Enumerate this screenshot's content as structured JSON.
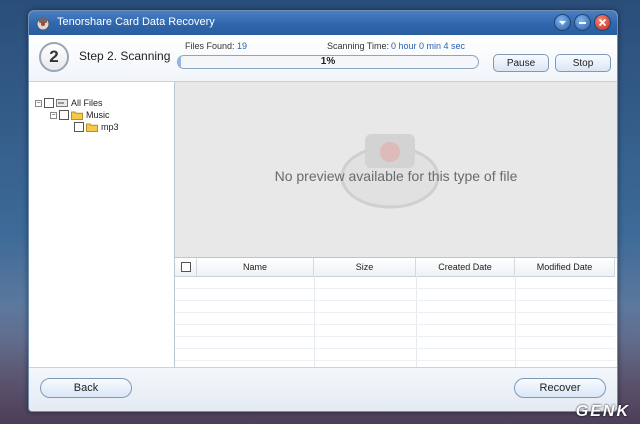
{
  "window": {
    "title": "Tenorshare Card Data Recovery",
    "controls": [
      "help-icon",
      "minimize-icon",
      "close-icon"
    ]
  },
  "step": {
    "number": "2",
    "title": "Step 2. Scanning",
    "files_found_label": "Files Found:",
    "files_found_value": "19",
    "scanning_time_label": "Scanning Time:",
    "scanning_time_value": "0 hour 0 min 4 sec",
    "progress_text": "1%",
    "progress_fraction": 0.01,
    "pause_label": "Pause",
    "stop_label": "Stop"
  },
  "tree": {
    "items": [
      {
        "label": "All Files",
        "icon": "drive-icon",
        "expander": "−"
      },
      {
        "label": "Music",
        "icon": "folder-icon",
        "expander": "−"
      },
      {
        "label": "mp3",
        "icon": "folder-icon"
      }
    ]
  },
  "preview": {
    "message": "No preview available for this type of file"
  },
  "table": {
    "columns": [
      "Name",
      "Size",
      "Created Date",
      "Modified Date"
    ]
  },
  "footer": {
    "back_label": "Back",
    "recover_label": "Recover"
  },
  "watermark": "GENK",
  "colors": {
    "titlebar": "#2f66ad",
    "accent_text": "#2a62b0",
    "progress_fill": "#8fb8e6"
  }
}
